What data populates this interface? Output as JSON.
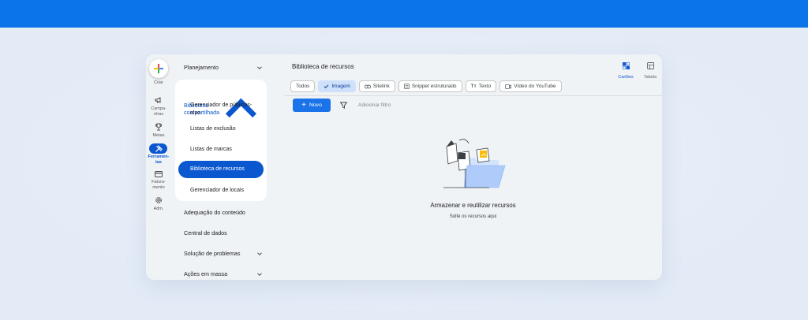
{
  "rail": {
    "create_label": "Criar",
    "items": [
      {
        "label": "Campa-\nnhas",
        "icon": "megaphone-icon"
      },
      {
        "label": "Metas",
        "icon": "trophy-icon"
      },
      {
        "label": "Ferramen-\ntas",
        "icon": "tools-icon",
        "active": true
      },
      {
        "label": "Fatura-\nmento",
        "icon": "credit-card-icon"
      },
      {
        "label": "Adm.",
        "icon": "gear-icon"
      }
    ]
  },
  "nav": {
    "planning": "Planejamento",
    "shared_library": "Biblioteca compartilhada",
    "sub_items": [
      "Gerenciador de públicos-alvo",
      "Listas de exclusão",
      "Listas de marcas",
      "Biblioteca de recursos",
      "Gerenciador de locais"
    ],
    "content_suitability": "Adequação do conteúdo",
    "data_manager": "Central de dados",
    "troubleshooting": "Solução de problemas",
    "bulk_actions": "Ações em massa"
  },
  "main": {
    "title": "Biblioteca de recursos",
    "views": {
      "cards": "Cartões",
      "table": "Tabela"
    },
    "chips": [
      "Todos",
      "Imagem",
      "Sitelink",
      "Snippet estruturado",
      "Texto",
      "Vídeo do YouTube"
    ],
    "new_button": "Novo",
    "add_filter": "Adicionar filtro",
    "empty_title": "Armazenar e reutilizar recursos",
    "empty_subtitle": "Solte os recursos aqui"
  },
  "colors": {
    "accent": "#0b57d0",
    "topbar": "#0b74e8",
    "button": "#1a73e8",
    "chip_selected": "#cfe0fb"
  }
}
